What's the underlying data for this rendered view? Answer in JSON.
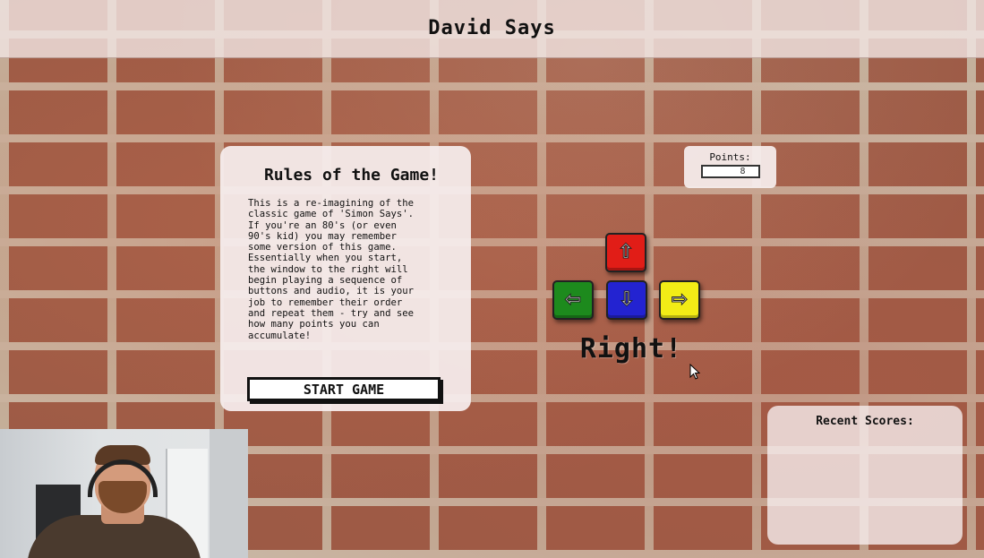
{
  "app": {
    "title": "David Says"
  },
  "rules": {
    "title": "Rules of the Game!",
    "body": "This is a re-imagining of the\nclassic game of 'Simon Says'.\nIf you're an 80's (or even\n90's kid) you may remember\nsome version of this game.\nEssentially when you start,\nthe window to the right will\nbegin playing a sequence of\nbuttons and audio, it is your\njob to remember their order\nand repeat them - try and see\nhow many points you can\naccumulate!",
    "start_label": "START GAME"
  },
  "points": {
    "label": "Points:",
    "value": "8"
  },
  "arrows": {
    "up": {
      "glyph": "⇧",
      "color": "#e11d17"
    },
    "left": {
      "glyph": "⇦",
      "color": "#1d8a1d"
    },
    "down": {
      "glyph": "⇩",
      "color": "#2323d1"
    },
    "right": {
      "glyph": "⇨",
      "color": "#f2ec16"
    }
  },
  "feedback": "Right!",
  "recent_scores": {
    "title": "Recent Scores:"
  }
}
